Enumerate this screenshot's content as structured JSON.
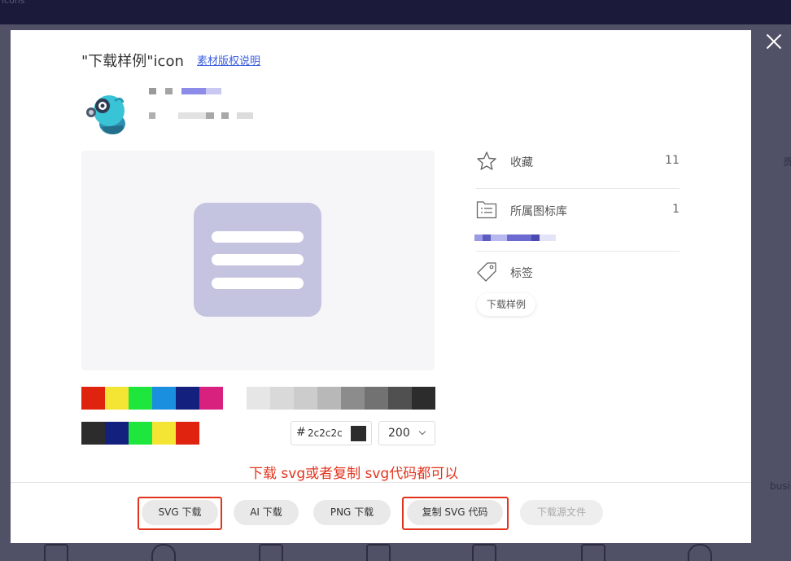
{
  "background": {
    "topbar_text": "icons",
    "side_text_1": "贡",
    "side_text_2": "busi"
  },
  "modal": {
    "title": "\"下载样例\"icon",
    "copyright_link": "素材版权说明",
    "close_icon": "close-icon"
  },
  "preview": {
    "icon": "list-icon",
    "fill_color": "#c5c4e0"
  },
  "colors": {
    "palette": [
      "#e0230f",
      "#f4e535",
      "#1ee63c",
      "#1a8fe0",
      "#13207e",
      "#d8217f",
      "#ffffff"
    ],
    "grays": [
      "#e6e6e6",
      "#d9d9d9",
      "#cccccc",
      "#b8b8b8",
      "#8c8c8c",
      "#727272",
      "#505050",
      "#2c2c2c"
    ],
    "recent": [
      "#2c2c2c",
      "#13207e",
      "#1ee63c",
      "#f4e535",
      "#e0230f"
    ],
    "hex_hash": "#",
    "hex_value": "2c2c2c",
    "size_value": "200"
  },
  "hint": "下载 svg或者复制 svg代码都可以",
  "info": {
    "favorite_label": "收藏",
    "favorite_count": "11",
    "library_label": "所属图标库",
    "library_count": "1",
    "tags_label": "标签",
    "tag": "下载样例"
  },
  "buttons": {
    "svg_download": "SVG 下载",
    "ai_download": "AI 下载",
    "png_download": "PNG 下载",
    "copy_svg": "复制 SVG 代码",
    "source_download": "下载源文件"
  },
  "accent_color": "#e2341d"
}
